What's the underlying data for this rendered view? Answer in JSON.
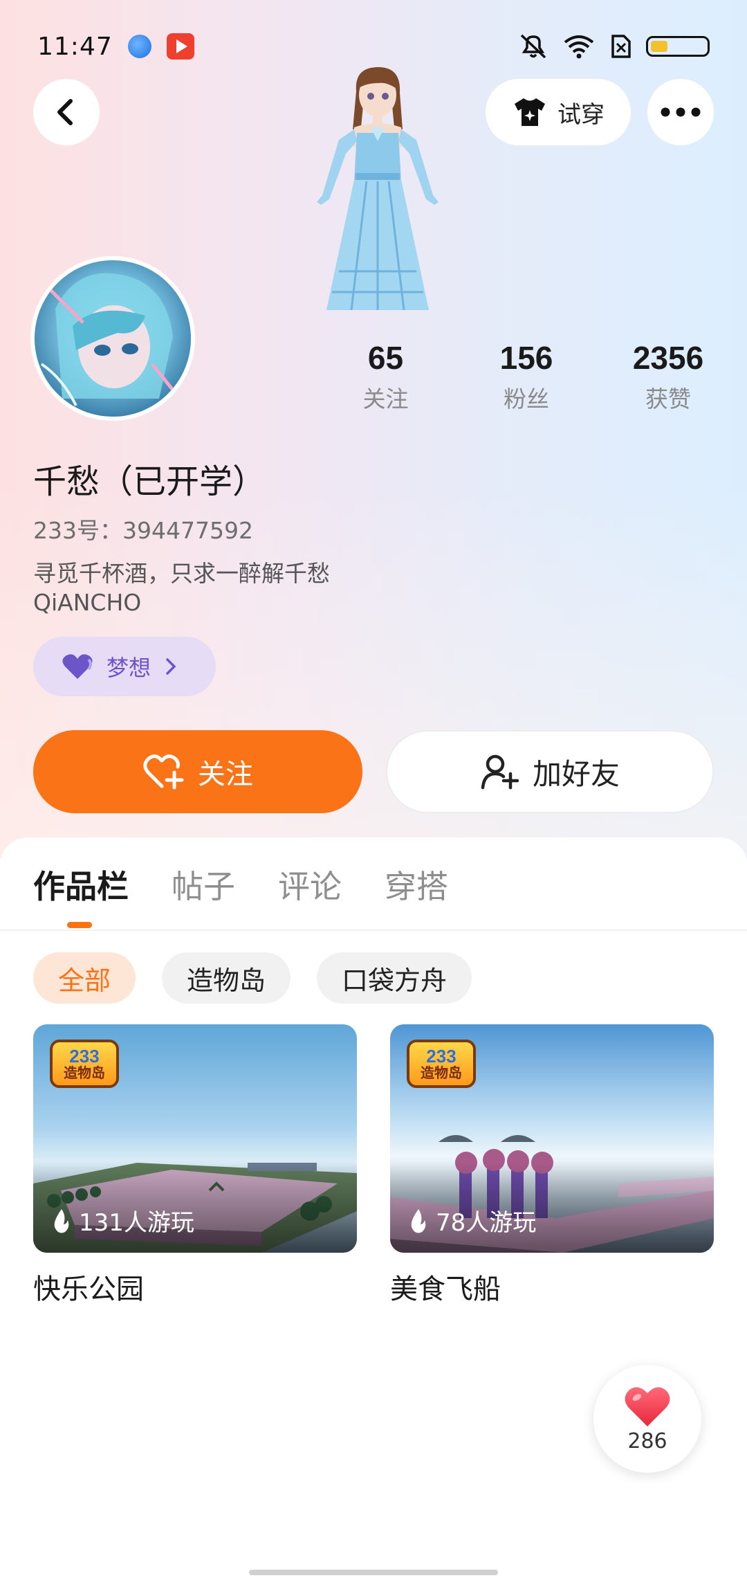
{
  "status_bar": {
    "time": "11:47"
  },
  "header": {
    "tryon_label": "试穿"
  },
  "profile": {
    "stats": [
      {
        "value": "65",
        "label": "关注"
      },
      {
        "value": "156",
        "label": "粉丝"
      },
      {
        "value": "2356",
        "label": "获赞"
      }
    ],
    "name": "千愁（已开学）",
    "uid": "233号：394477592",
    "bio_line1": "寻觅千杯酒，只求一醉解千愁",
    "bio_line2": "QiANCHO",
    "dream_tag": "梦想"
  },
  "actions": {
    "follow_label": "关注",
    "add_friend_label": "加好友"
  },
  "tabs": [
    {
      "label": "作品栏",
      "active": true
    },
    {
      "label": "帖子",
      "active": false
    },
    {
      "label": "评论",
      "active": false
    },
    {
      "label": "穿搭",
      "active": false
    }
  ],
  "filters": [
    {
      "label": "全部",
      "active": true
    },
    {
      "label": "造物岛",
      "active": false
    },
    {
      "label": "口袋方舟",
      "active": false
    }
  ],
  "works": [
    {
      "title": "快乐公园",
      "players": "131人游玩",
      "badge_num": "233",
      "badge_text": "造物岛"
    },
    {
      "title": "美食飞船",
      "players": "78人游玩",
      "badge_num": "233",
      "badge_text": "造物岛"
    }
  ],
  "like_fab": {
    "count": "286"
  },
  "colors": {
    "accent": "#fa7316",
    "dream": "#6b55c9"
  }
}
